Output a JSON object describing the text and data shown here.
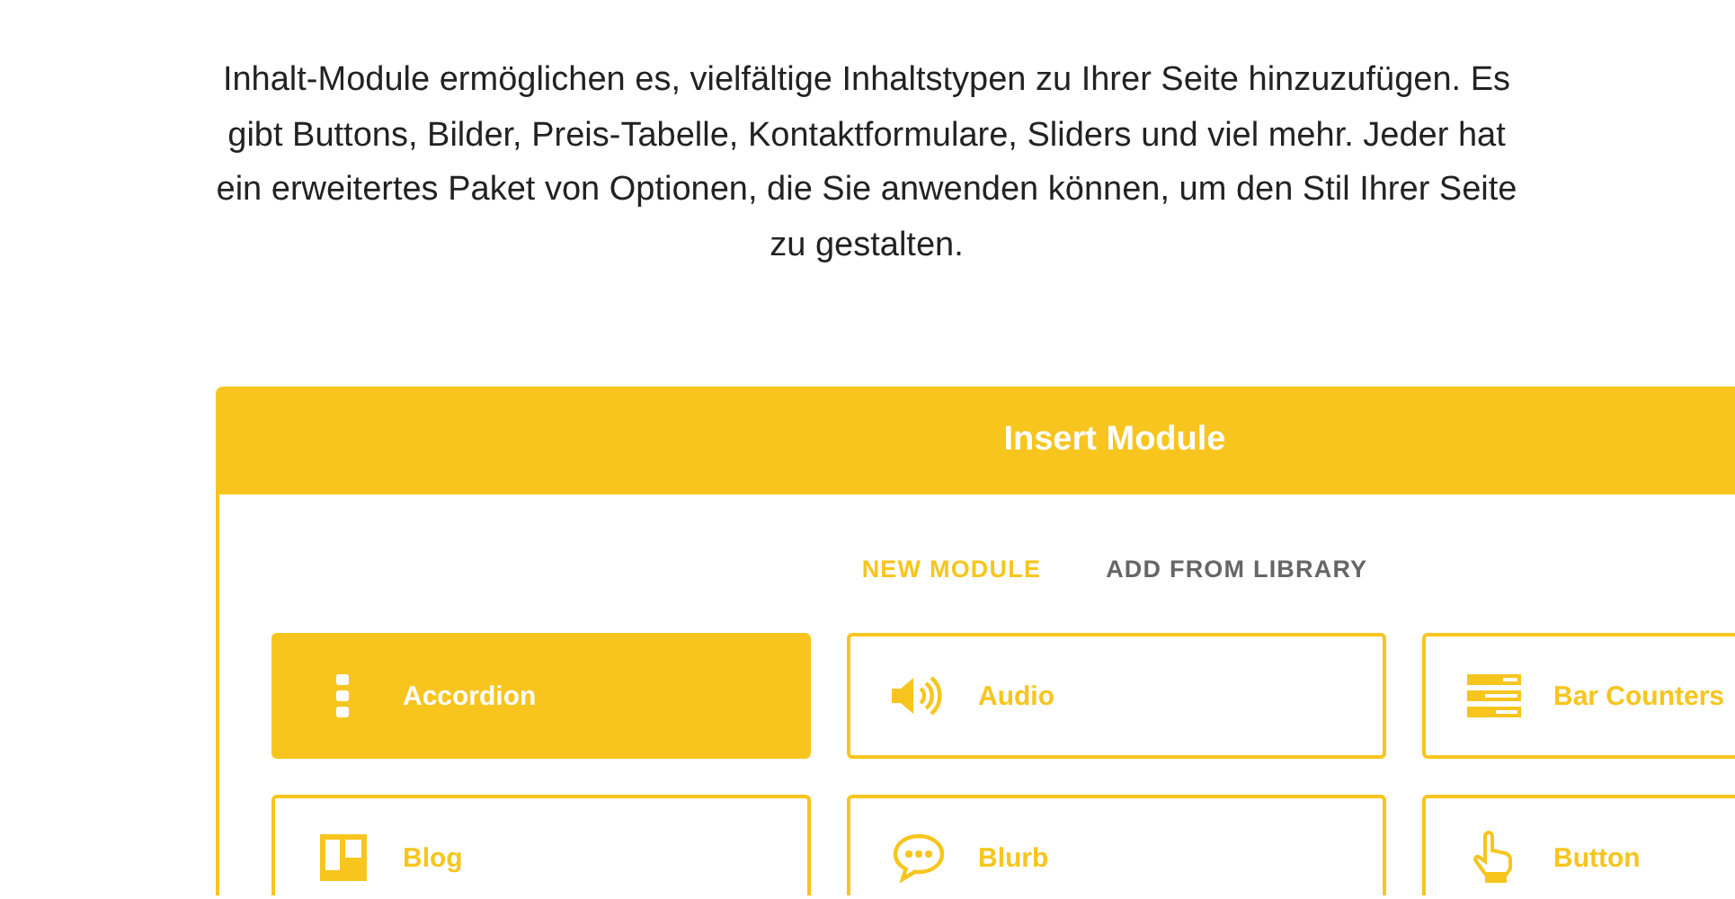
{
  "intro": "Inhalt-Module ermöglichen es, vielfältige Inhaltstypen zu Ihrer Seite hinzuzufügen. Es gibt Buttons, Bilder, Preis-Tabelle, Kontaktformulare, Sliders und viel mehr. Jeder hat ein erweitertes Paket von Optionen, die Sie anwenden können, um den Stil Ihrer Seite zu gestalten.",
  "modal": {
    "title": "Insert Module",
    "tabs": [
      {
        "label": "NEW MODULE",
        "selected": true
      },
      {
        "label": "ADD FROM LIBRARY",
        "selected": false
      }
    ],
    "modules": [
      {
        "label": "Accordion",
        "selected": true
      },
      {
        "label": "Audio",
        "selected": false
      },
      {
        "label": "Bar Counters",
        "selected": false
      },
      {
        "label": "Blog",
        "selected": false
      },
      {
        "label": "Blurb",
        "selected": false
      },
      {
        "label": "Button",
        "selected": false
      }
    ]
  }
}
